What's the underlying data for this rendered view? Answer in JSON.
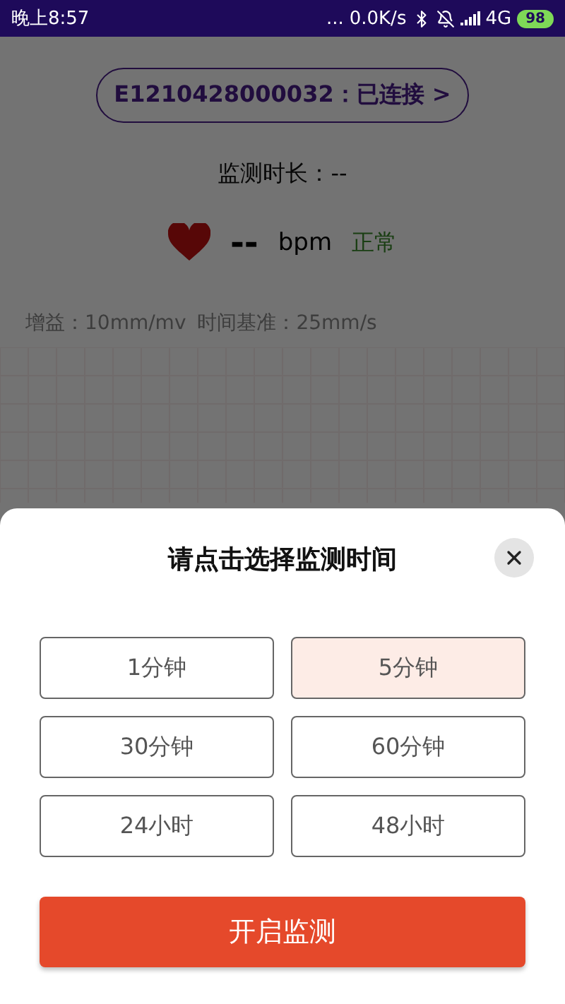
{
  "status_bar": {
    "time": "晚上8:57",
    "more": "...",
    "speed": "0.0K/s",
    "network": "4G",
    "battery": "98"
  },
  "device": {
    "label": "E1210428000032：已连接 >"
  },
  "duration": "监测时长：--",
  "heart_rate": {
    "value": "--",
    "unit": "bpm",
    "status": "正常"
  },
  "ecg_scale": {
    "gain": "增益：10mm/mv",
    "time_base": "时间基准：25mm/s"
  },
  "sheet": {
    "title": "请点击选择监测时间",
    "options": [
      {
        "label": "1分钟",
        "selected": false
      },
      {
        "label": "5分钟",
        "selected": true
      },
      {
        "label": "30分钟",
        "selected": false
      },
      {
        "label": "60分钟",
        "selected": false
      },
      {
        "label": "24小时",
        "selected": false
      },
      {
        "label": "48小时",
        "selected": false
      }
    ],
    "start_button": "开启监测"
  }
}
